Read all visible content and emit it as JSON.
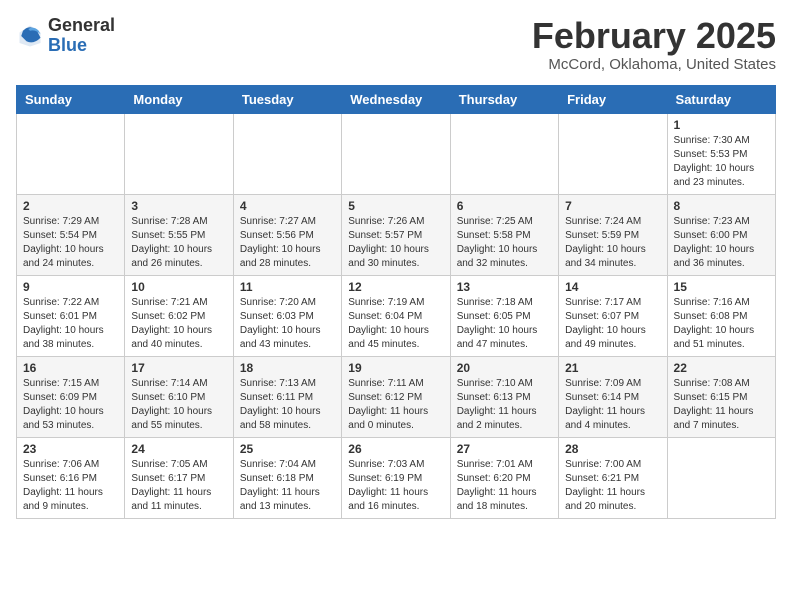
{
  "header": {
    "logo_general": "General",
    "logo_blue": "Blue",
    "month_title": "February 2025",
    "location": "McCord, Oklahoma, United States"
  },
  "days_of_week": [
    "Sunday",
    "Monday",
    "Tuesday",
    "Wednesday",
    "Thursday",
    "Friday",
    "Saturday"
  ],
  "weeks": [
    [
      {
        "day": "",
        "info": ""
      },
      {
        "day": "",
        "info": ""
      },
      {
        "day": "",
        "info": ""
      },
      {
        "day": "",
        "info": ""
      },
      {
        "day": "",
        "info": ""
      },
      {
        "day": "",
        "info": ""
      },
      {
        "day": "1",
        "info": "Sunrise: 7:30 AM\nSunset: 5:53 PM\nDaylight: 10 hours\nand 23 minutes."
      }
    ],
    [
      {
        "day": "2",
        "info": "Sunrise: 7:29 AM\nSunset: 5:54 PM\nDaylight: 10 hours\nand 24 minutes."
      },
      {
        "day": "3",
        "info": "Sunrise: 7:28 AM\nSunset: 5:55 PM\nDaylight: 10 hours\nand 26 minutes."
      },
      {
        "day": "4",
        "info": "Sunrise: 7:27 AM\nSunset: 5:56 PM\nDaylight: 10 hours\nand 28 minutes."
      },
      {
        "day": "5",
        "info": "Sunrise: 7:26 AM\nSunset: 5:57 PM\nDaylight: 10 hours\nand 30 minutes."
      },
      {
        "day": "6",
        "info": "Sunrise: 7:25 AM\nSunset: 5:58 PM\nDaylight: 10 hours\nand 32 minutes."
      },
      {
        "day": "7",
        "info": "Sunrise: 7:24 AM\nSunset: 5:59 PM\nDaylight: 10 hours\nand 34 minutes."
      },
      {
        "day": "8",
        "info": "Sunrise: 7:23 AM\nSunset: 6:00 PM\nDaylight: 10 hours\nand 36 minutes."
      }
    ],
    [
      {
        "day": "9",
        "info": "Sunrise: 7:22 AM\nSunset: 6:01 PM\nDaylight: 10 hours\nand 38 minutes."
      },
      {
        "day": "10",
        "info": "Sunrise: 7:21 AM\nSunset: 6:02 PM\nDaylight: 10 hours\nand 40 minutes."
      },
      {
        "day": "11",
        "info": "Sunrise: 7:20 AM\nSunset: 6:03 PM\nDaylight: 10 hours\nand 43 minutes."
      },
      {
        "day": "12",
        "info": "Sunrise: 7:19 AM\nSunset: 6:04 PM\nDaylight: 10 hours\nand 45 minutes."
      },
      {
        "day": "13",
        "info": "Sunrise: 7:18 AM\nSunset: 6:05 PM\nDaylight: 10 hours\nand 47 minutes."
      },
      {
        "day": "14",
        "info": "Sunrise: 7:17 AM\nSunset: 6:07 PM\nDaylight: 10 hours\nand 49 minutes."
      },
      {
        "day": "15",
        "info": "Sunrise: 7:16 AM\nSunset: 6:08 PM\nDaylight: 10 hours\nand 51 minutes."
      }
    ],
    [
      {
        "day": "16",
        "info": "Sunrise: 7:15 AM\nSunset: 6:09 PM\nDaylight: 10 hours\nand 53 minutes."
      },
      {
        "day": "17",
        "info": "Sunrise: 7:14 AM\nSunset: 6:10 PM\nDaylight: 10 hours\nand 55 minutes."
      },
      {
        "day": "18",
        "info": "Sunrise: 7:13 AM\nSunset: 6:11 PM\nDaylight: 10 hours\nand 58 minutes."
      },
      {
        "day": "19",
        "info": "Sunrise: 7:11 AM\nSunset: 6:12 PM\nDaylight: 11 hours\nand 0 minutes."
      },
      {
        "day": "20",
        "info": "Sunrise: 7:10 AM\nSunset: 6:13 PM\nDaylight: 11 hours\nand 2 minutes."
      },
      {
        "day": "21",
        "info": "Sunrise: 7:09 AM\nSunset: 6:14 PM\nDaylight: 11 hours\nand 4 minutes."
      },
      {
        "day": "22",
        "info": "Sunrise: 7:08 AM\nSunset: 6:15 PM\nDaylight: 11 hours\nand 7 minutes."
      }
    ],
    [
      {
        "day": "23",
        "info": "Sunrise: 7:06 AM\nSunset: 6:16 PM\nDaylight: 11 hours\nand 9 minutes."
      },
      {
        "day": "24",
        "info": "Sunrise: 7:05 AM\nSunset: 6:17 PM\nDaylight: 11 hours\nand 11 minutes."
      },
      {
        "day": "25",
        "info": "Sunrise: 7:04 AM\nSunset: 6:18 PM\nDaylight: 11 hours\nand 13 minutes."
      },
      {
        "day": "26",
        "info": "Sunrise: 7:03 AM\nSunset: 6:19 PM\nDaylight: 11 hours\nand 16 minutes."
      },
      {
        "day": "27",
        "info": "Sunrise: 7:01 AM\nSunset: 6:20 PM\nDaylight: 11 hours\nand 18 minutes."
      },
      {
        "day": "28",
        "info": "Sunrise: 7:00 AM\nSunset: 6:21 PM\nDaylight: 11 hours\nand 20 minutes."
      },
      {
        "day": "",
        "info": ""
      }
    ]
  ]
}
